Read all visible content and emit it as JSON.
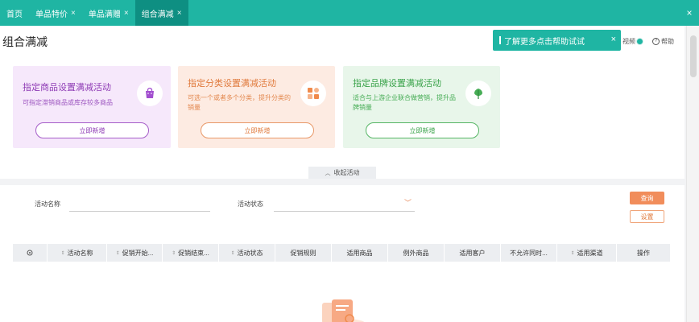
{
  "tabs": [
    {
      "label": "首页",
      "closable": false,
      "active": false
    },
    {
      "label": "单品特价",
      "closable": true,
      "active": false
    },
    {
      "label": "单品满赠",
      "closable": true,
      "active": false
    },
    {
      "label": "组合满减",
      "closable": true,
      "active": true
    }
  ],
  "tab_close_glyph": "×",
  "page_title": "组合满减",
  "help_toast": {
    "text": "了解更多点击帮助试试",
    "close": "×"
  },
  "newbie_label": "视频",
  "help_label": "帮助",
  "cards": {
    "product": {
      "title": "指定商品设置满减活动",
      "desc": "可指定滞销商品或库存较多商品",
      "button": "立即新增",
      "icon": "bag-icon"
    },
    "category": {
      "title": "指定分类设置满减活动",
      "desc_line1": "可选一个或者多个分类，提升分类的",
      "desc_line2": "销量",
      "button": "立即新增",
      "icon": "category-grid-icon"
    },
    "brand": {
      "title": "指定品牌设置满减活动",
      "desc_line1": "适合与上游企业联合做营销，提升品",
      "desc_line2": "牌销量",
      "button": "立即新增",
      "icon": "leaf-icon"
    }
  },
  "collapse_label": "收起活动",
  "search": {
    "name_label": "活动名称",
    "status_label": "活动状态",
    "query_button": "查询",
    "reset_button": "设置"
  },
  "table_columns": [
    "活动名称",
    "促销开始...",
    "促销结束...",
    "活动状态",
    "促销规则",
    "适用商品",
    "例外商品",
    "适用客户",
    "不允许同时...",
    "适用渠道",
    "操作"
  ],
  "colors": {
    "primary": "#1fb5a3",
    "accent": "#f18d5b"
  }
}
